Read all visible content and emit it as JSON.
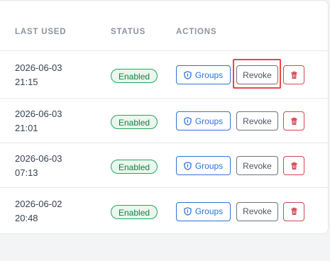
{
  "columns": {
    "last_used": "LAST USED",
    "status": "STATUS",
    "actions": "ACTIONS"
  },
  "rows": [
    {
      "date": "2026-06-03",
      "time": "21:15",
      "status": "Enabled",
      "groups_label": "Groups",
      "revoke_label": "Revoke"
    },
    {
      "date": "2026-06-03",
      "time": "21:01",
      "status": "Enabled",
      "groups_label": "Groups",
      "revoke_label": "Revoke"
    },
    {
      "date": "2026-06-03",
      "time": "07:13",
      "status": "Enabled",
      "groups_label": "Groups",
      "revoke_label": "Revoke"
    },
    {
      "date": "2026-06-02",
      "time": "20:48",
      "status": "Enabled",
      "groups_label": "Groups",
      "revoke_label": "Revoke"
    }
  ],
  "icons": {
    "groups": "shield-icon",
    "delete": "trash-icon"
  },
  "colors": {
    "enabled": "#16803c",
    "primary": "#2f72d6",
    "danger": "#d64550",
    "highlight": "#ef4444"
  }
}
